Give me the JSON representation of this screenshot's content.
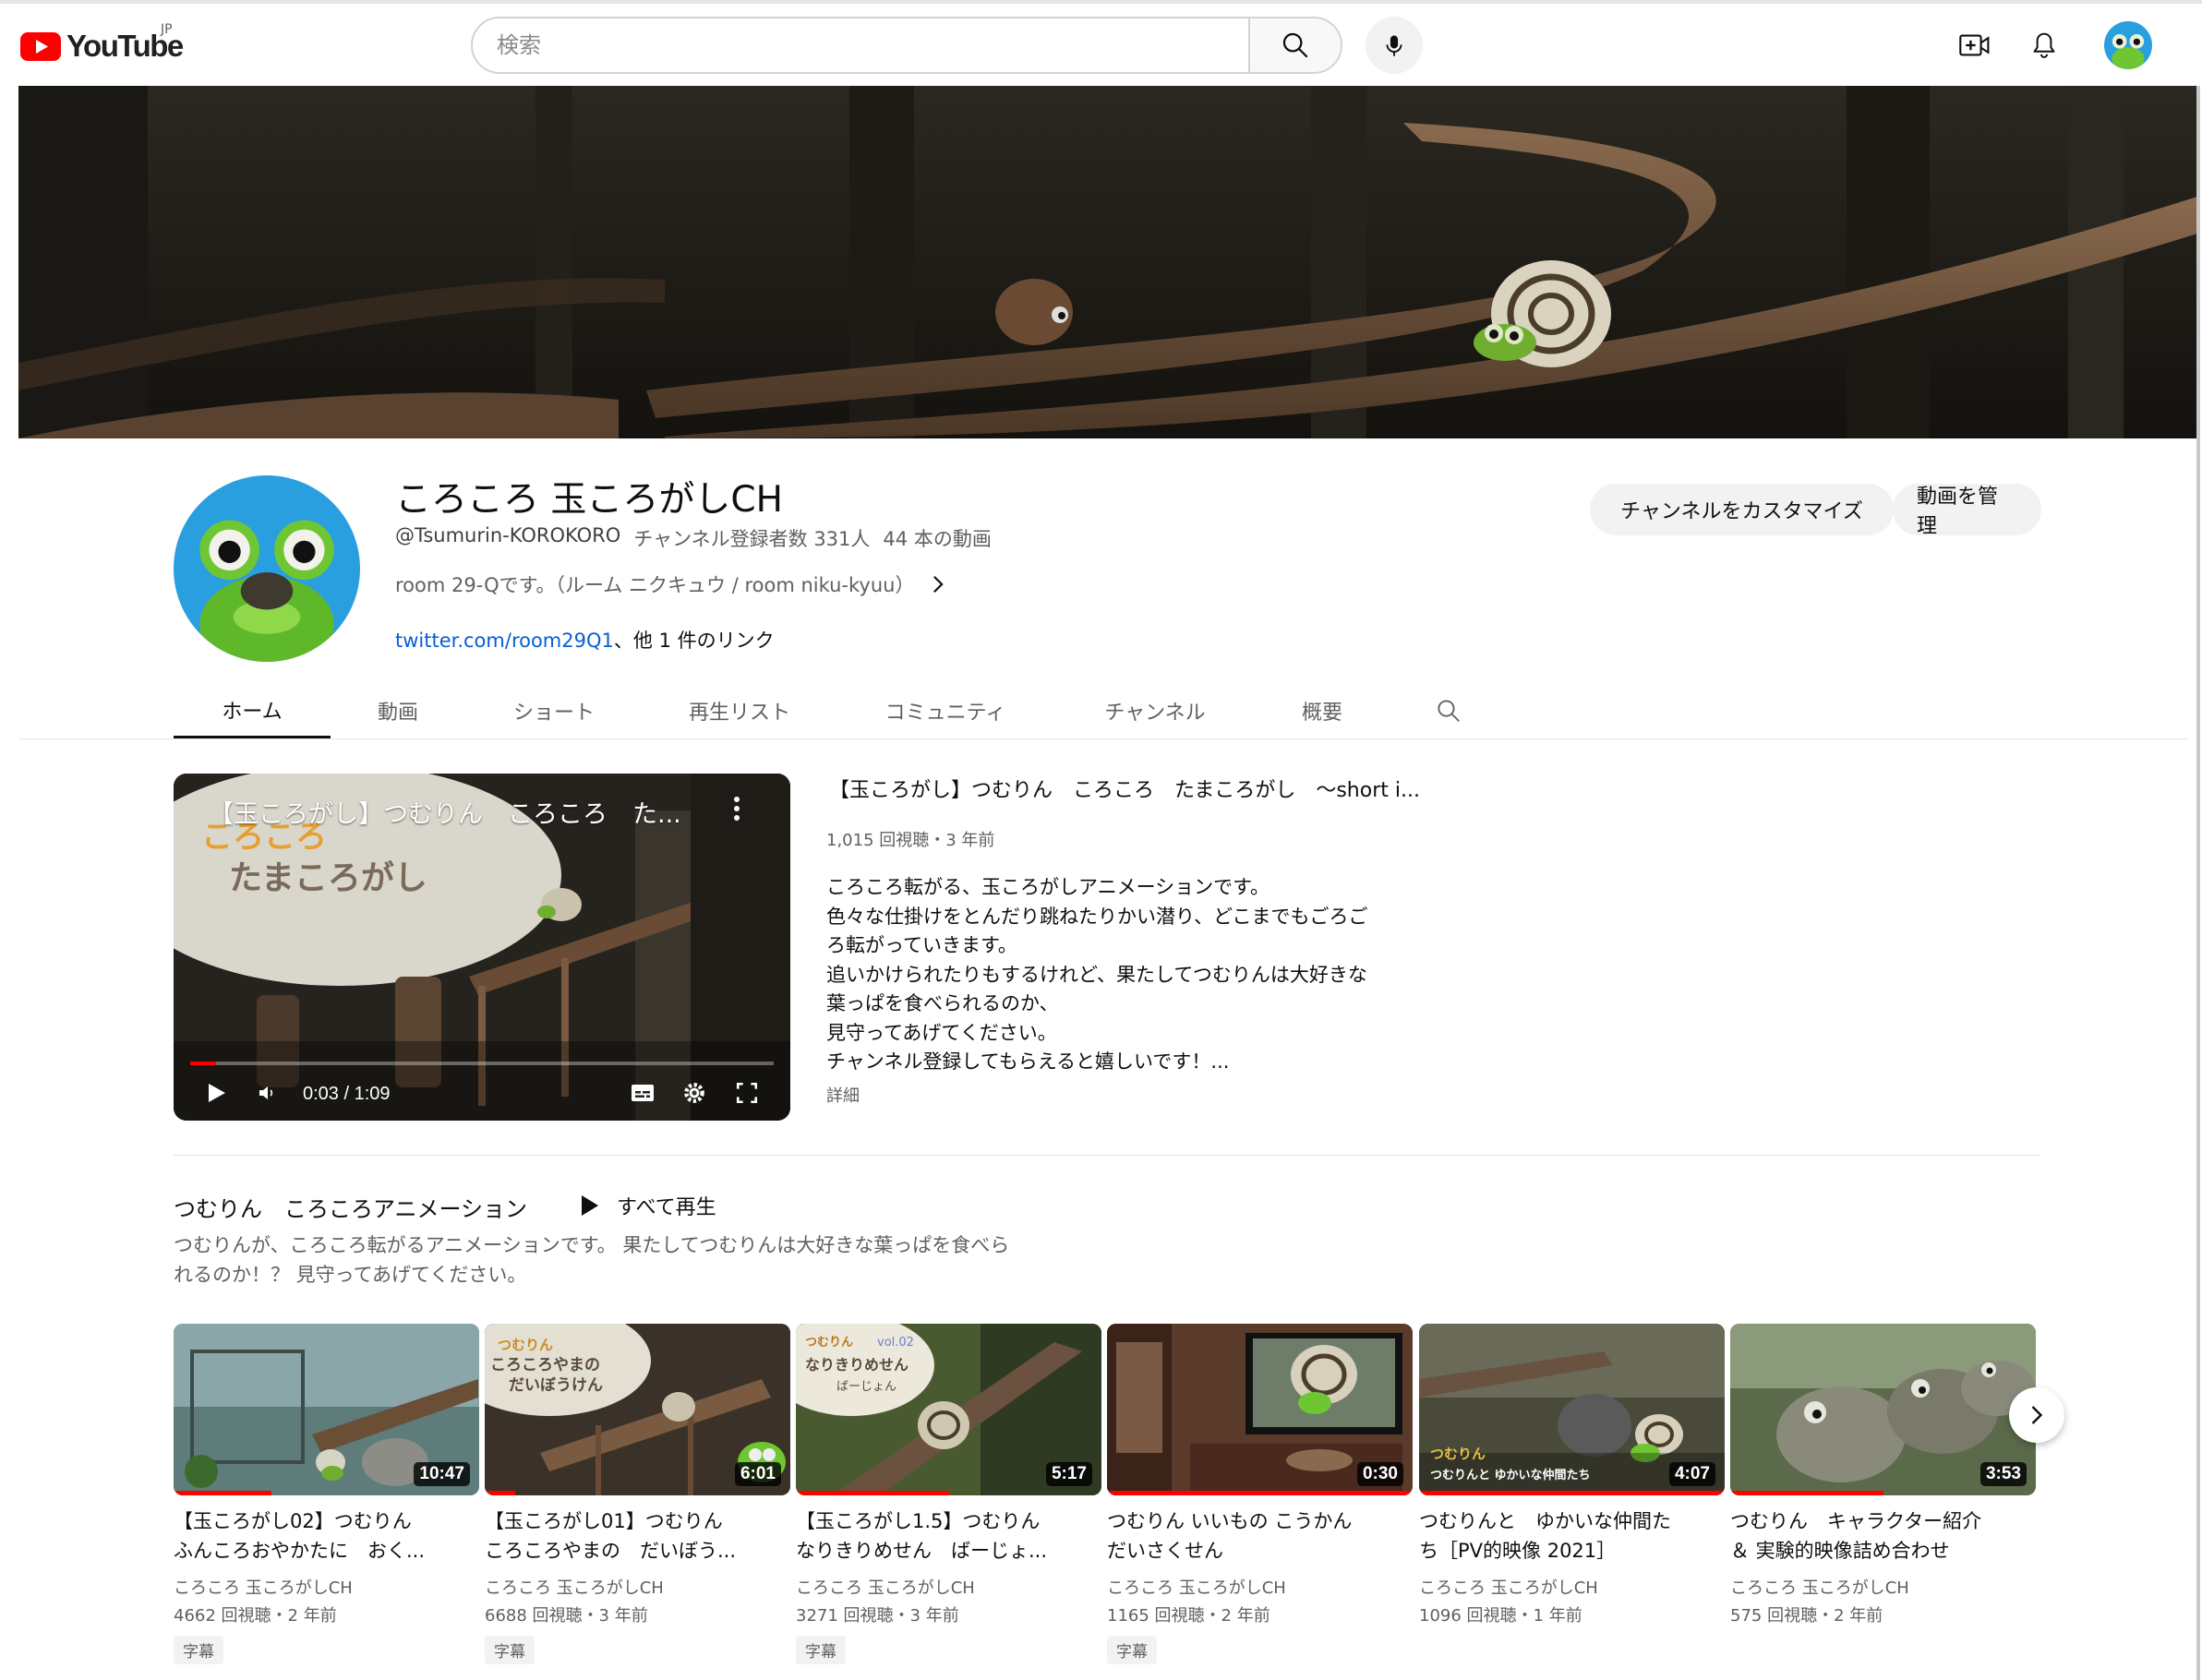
{
  "masthead": {
    "logo_text": "YouTube",
    "region": "JP",
    "search_placeholder": "検索",
    "icons": [
      "create-video-icon",
      "notifications-bell-icon",
      "account-avatar"
    ]
  },
  "channel": {
    "name": "ころころ 玉ころがしCH",
    "handle": "@Tsumurin-KOROKORO",
    "subscribers": "チャンネル登録者数 331人",
    "video_count": "44 本の動画",
    "description": "room 29-Qです。（ルーム ニクキュウ / room niku-kyuu）",
    "link": "twitter.com/room29Q1",
    "link_sep": "、",
    "other_links": "他 1 件のリンク",
    "customize_button": "チャンネルをカスタマイズ",
    "manage_button": "動画を管理"
  },
  "tabs": [
    "ホーム",
    "動画",
    "ショート",
    "再生リスト",
    "コミュニティ",
    "チャンネル",
    "概要"
  ],
  "featured": {
    "overlay_title": "【玉ころがし】つむりん　ころころ　た...",
    "title": "【玉ころがし】つむりん　ころころ　たまころがし　～short i...",
    "meta": "1,015 回視聴・3 年前",
    "time": "0:03 / 1:09",
    "progress": 0.045,
    "description": [
      "ころころ転がる、玉ころがしアニメーションです。",
      "色々な仕掛けをとんだり跳ねたりかい潜り、どこまでもごろご",
      "ろ転がっていきます。",
      "追いかけられたりもするけれど、果たしてつむりんは大好きな",
      "葉っぱを食べられるのか、",
      "見守ってあげてください。",
      "チャンネル登録してもらえると嬉しいです！..."
    ],
    "more": "詳細"
  },
  "shelf": {
    "title": "つむりん　ころころアニメーション",
    "play_all": "すべて再生",
    "description": [
      "つむりんが、ころころ転がるアニメーションです。 果たしてつむりんは大好きな葉っぱを食べら",
      "れるのか！？ 見守ってあげてください。"
    ],
    "videos": [
      {
        "title1": "【玉ころがし02】つむりん",
        "title2": "ふんころおやかたに　おく...",
        "duration": "10:47",
        "channel": "ころころ 玉ころがしCH",
        "views": "4662 回視聴・2 年前",
        "badge": "字幕",
        "watched": 0.32,
        "thumb_text": ""
      },
      {
        "title1": "【玉ころがし01】つむりん",
        "title2": "ころころやまの　だいぼう...",
        "duration": "6:01",
        "channel": "ころころ 玉ころがしCH",
        "views": "6688 回視聴・3 年前",
        "badge": "字幕",
        "watched": 0.1,
        "thumb_text": "つむりん ころころやまの だいぼうけん"
      },
      {
        "title1": "【玉ころがし1.5】つむりん",
        "title2": "なりきりめせん　ばーじょ...",
        "duration": "5:17",
        "channel": "ころころ 玉ころがしCH",
        "views": "3271 回視聴・3 年前",
        "badge": "字幕",
        "watched": 0.5,
        "thumb_text": "つむりん なりきりめせん ばーじょん vol.02"
      },
      {
        "title1": "つむりん いいもの こうかん",
        "title2": "だいさくせん",
        "duration": "0:30",
        "channel": "ころころ 玉ころがしCH",
        "views": "1165 回視聴・2 年前",
        "badge": "字幕",
        "watched": 1.0,
        "thumb_text": ""
      },
      {
        "title1": "つむりんと　ゆかいな仲間た",
        "title2": "ち［PV的映像 2021］",
        "duration": "4:07",
        "channel": "ころころ 玉ころがしCH",
        "views": "1096 回視聴・1 年前",
        "badge": "",
        "watched": 1.0,
        "thumb_text": "つむりんと ゆかいな仲間たち"
      },
      {
        "title1": "つむりん　キャラクター紹介",
        "title2": "＆ 実験的映像詰め合わせ",
        "duration": "3:53",
        "channel": "ころころ 玉ころがしCH",
        "views": "575 回視聴・2 年前",
        "badge": "",
        "watched": 0.5,
        "thumb_text": ""
      }
    ]
  },
  "colors": {
    "brand_red": "#ff0000",
    "link_blue": "#065fd4",
    "text_secondary": "#606060"
  }
}
